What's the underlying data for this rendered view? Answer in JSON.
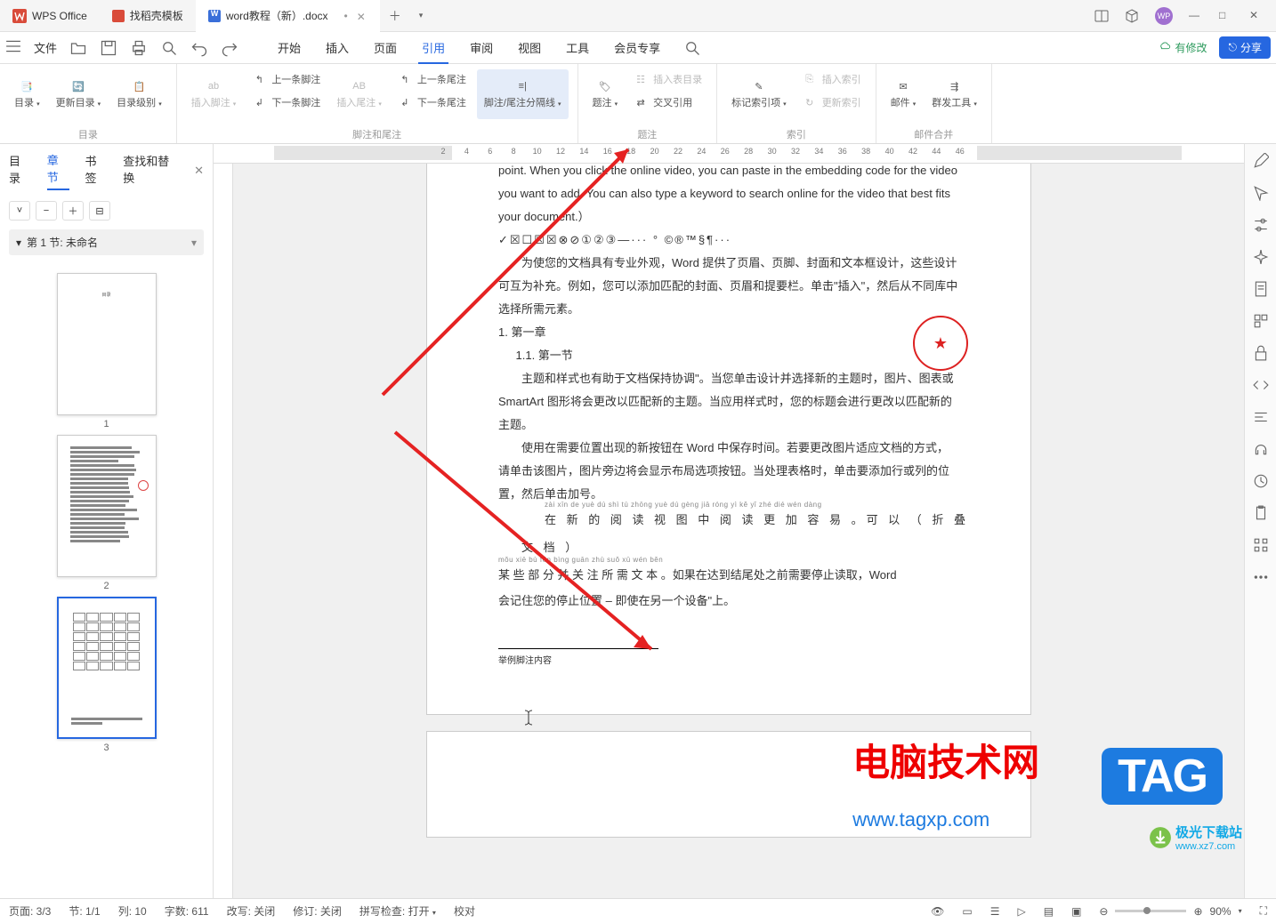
{
  "titlebar": {
    "app_name": "WPS Office",
    "template_tab": "找稻壳模板",
    "doc_tab": "word教程（新）.docx"
  },
  "window": {
    "min": "—",
    "max": "□",
    "close": "✕"
  },
  "menubar": {
    "file": "文件",
    "tabs": [
      "开始",
      "插入",
      "页面",
      "引用",
      "审阅",
      "视图",
      "工具",
      "会员专享"
    ],
    "active_index": 3,
    "sync_badge": "有修改",
    "share": "分享"
  },
  "ribbon": {
    "groups": [
      {
        "label": "目录",
        "items": [
          "目录",
          "更新目录",
          "目录级别"
        ]
      },
      {
        "label": "脚注和尾注",
        "items": [
          "插入脚注",
          "上一条脚注",
          "下一条脚注",
          "插入尾注",
          "上一条尾注",
          "下一条尾注",
          "脚注/尾注分隔线"
        ],
        "highlight_index": 6
      },
      {
        "label": "题注",
        "items": [
          "题注",
          "插入表目录",
          "交叉引用"
        ]
      },
      {
        "label": "索引",
        "items": [
          "标记索引项",
          "插入索引",
          "更新索引"
        ]
      },
      {
        "label": "邮件合并",
        "items": [
          "邮件",
          "群发工具"
        ]
      }
    ]
  },
  "left_panel": {
    "tabs": [
      "目录",
      "章节",
      "书签",
      "查找和替换"
    ],
    "active_index": 1,
    "section_select": "第 1 节: 未命名",
    "thumbs": [
      "1",
      "2",
      "3"
    ],
    "selected_thumb": 2
  },
  "document": {
    "para1": "point. When you click the online video, you can paste in the embedding code for the video you want to add. You can also type a keyword to search online for the video that best fits your document.）",
    "symbols": "✓☒☐☒☒⊗⊘①②③—···  ° ©®™§¶···",
    "para2": "为使您的文档具有专业外观，Word 提供了页眉、页脚、封面和文本框设计，这些设计可互为补充。例如，您可以添加匹配的封面、页眉和提要栏。单击\"插入\"，然后从不同库中选择所需元素。",
    "h1": "1.   第一章",
    "h2": "1.1.  第一节",
    "para3": "主题和样式也有助于文档保持协调\"。当您单击设计并选择新的主题时，图片、图表或 SmartArt 图形将会更改以匹配新的主题。当应用样式时，您的标题会进行更改以匹配新的主题。",
    "para4": "使用在需要位置出现的新按钮在 Word 中保存时间。若要更改图片适应文档的方式，请单击该图片，图片旁边将会显示布局选项按钮。当处理表格时，单击要添加行或列的位置，然后单击加号。",
    "para5a_pinyin": "zài xīn de yuè dú shì tú zhōng yuè dú gèng jiā róng yì     kě yǐ        zhé dié wén dàng",
    "para5a": "在 新 的 阅 读 视 图 中 阅 读 更 加 容 易 。可 以 （ 折 叠 文 档 ）",
    "para5b_pinyin": "mǒu xiē bù fēn bìng guān zhù suǒ xū wén běn",
    "para5b": "某 些 部 分 并 关 注 所 需 文 本 。如果在达到结尾处之前需要停止读取，Word",
    "para5c": "会记住您的停止位置 – 即使在另一个设备\"上。",
    "footnote": "举例脚注内容"
  },
  "watermark": {
    "cn": "电脑技术网",
    "url": "www.tagxp.com",
    "tag": "TAG",
    "small_url": "www.xz7.com",
    "small_brand": "极光下载站"
  },
  "statusbar": {
    "page": "页面: 3/3",
    "section": "节: 1/1",
    "column": "列: 10",
    "words": "字数: 611",
    "track": "改写: 关闭",
    "revise": "修订: 关闭",
    "spell": "拼写检查: 打开",
    "proof": "校对",
    "zoom": "90%"
  },
  "ruler": {
    "start": 2,
    "end": 46
  }
}
